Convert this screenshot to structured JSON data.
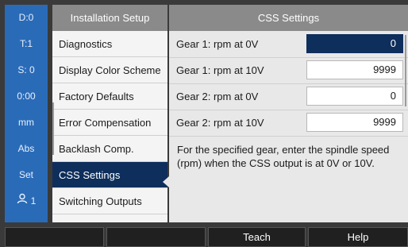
{
  "status_bar": {
    "items": [
      "D:0",
      "T:1",
      "S: 0",
      "0:00",
      "mm",
      "Abs",
      "Set"
    ],
    "user_number": "1"
  },
  "menu": {
    "title": "Installation Setup",
    "items": [
      {
        "label": "Diagnostics"
      },
      {
        "label": "Display Color Scheme"
      },
      {
        "label": "Factory Defaults"
      },
      {
        "label": "Error Compensation"
      },
      {
        "label": "Backlash Comp."
      },
      {
        "label": "CSS Settings"
      },
      {
        "label": "Switching Outputs"
      }
    ],
    "active_index": 5
  },
  "settings": {
    "title": "CSS Settings",
    "rows": [
      {
        "label": "Gear 1: rpm at 0V",
        "value": "0"
      },
      {
        "label": "Gear 1: rpm at 10V",
        "value": "9999"
      },
      {
        "label": "Gear 2: rpm at 0V",
        "value": "0"
      },
      {
        "label": "Gear 2: rpm at 10V",
        "value": "9999"
      }
    ],
    "selected_row": 0,
    "help_text": "For the specified gear, enter the spindle speed (rpm) when the CSS output is at 0V or 10V."
  },
  "softkeys": [
    "",
    "",
    "Teach",
    "Help"
  ],
  "colors": {
    "status_blue": "#2a6bb8",
    "selection_navy": "#0e2e5c",
    "header_gray": "#8a8a8a"
  }
}
